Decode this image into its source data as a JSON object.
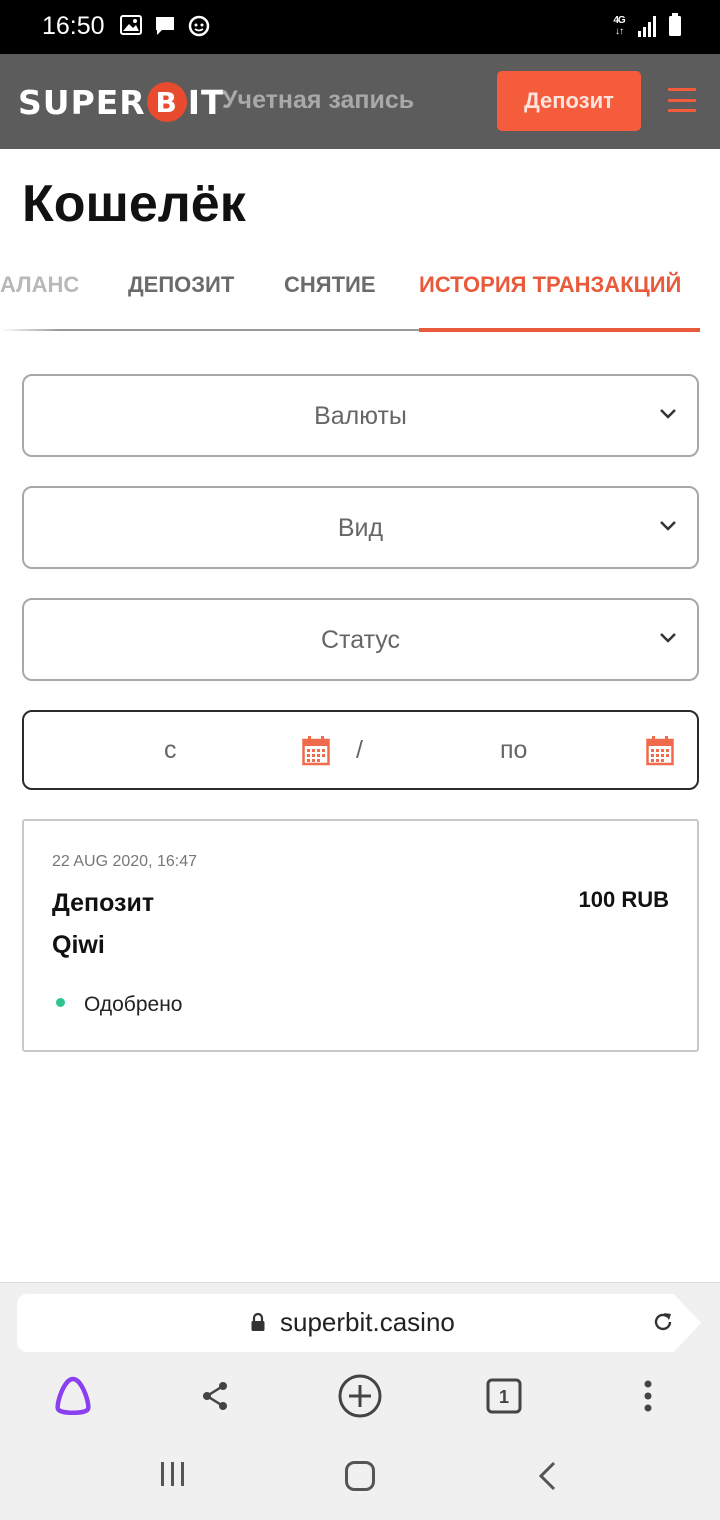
{
  "status_bar": {
    "time": "16:50",
    "network": "4G",
    "icons": [
      "gallery-icon",
      "message-icon",
      "app-icon",
      "signal-icon",
      "battery-icon"
    ]
  },
  "header": {
    "logo_text_left": "SUPER",
    "logo_b": "B",
    "logo_text_right": "IT",
    "account_link": "Учетная запись",
    "deposit_button": "Депозит",
    "accent_color": "#f55c3c"
  },
  "page": {
    "title": "Кошелёк"
  },
  "tabs": {
    "balance": "АЛАНС",
    "deposit": "ДЕПОЗИТ",
    "withdraw": "СНЯТИЕ",
    "history": "ИСТОРИЯ ТРАНЗАКЦИЙ",
    "active": "history"
  },
  "filters": {
    "currency": "Валюты",
    "type": "Вид",
    "status": "Статус",
    "date_from": "с",
    "date_separator": "/",
    "date_to": "по"
  },
  "transactions": [
    {
      "date": "22 AUG 2020, 16:47",
      "type": "Депозит",
      "method": "Qiwi",
      "amount": "100 RUB",
      "status": "Одобрено",
      "status_color": "#2ec48d"
    }
  ],
  "browser": {
    "url": "superbit.casino",
    "tab_count": "1"
  }
}
